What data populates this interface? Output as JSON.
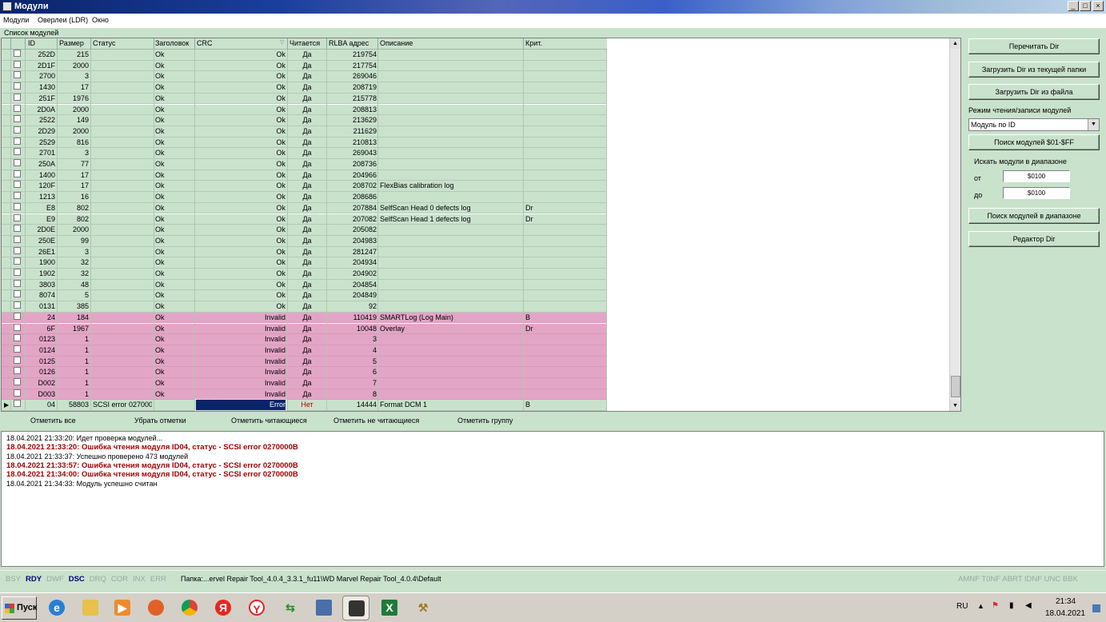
{
  "window": {
    "title": "Модули"
  },
  "menu": [
    "Модули",
    "Оверлеи (LDR)",
    "Окно"
  ],
  "list_title": "Список модулей",
  "columns": [
    "ID",
    "Размер",
    "Статус",
    "Заголовок",
    "CRC",
    "Читается",
    "RLBA адрес",
    "Описание",
    "Крит."
  ],
  "rows": [
    {
      "id": "252D",
      "size": "215",
      "status": "",
      "header": "Ok",
      "crc": "Ok",
      "readable": "Да",
      "rlba": "219754",
      "desc": "",
      "crit": "",
      "kind": "ok"
    },
    {
      "id": "2D1F",
      "size": "2000",
      "status": "",
      "header": "Ok",
      "crc": "Ok",
      "readable": "Да",
      "rlba": "217754",
      "desc": "",
      "crit": "",
      "kind": "ok"
    },
    {
      "id": "2700",
      "size": "3",
      "status": "",
      "header": "Ok",
      "crc": "Ok",
      "readable": "Да",
      "rlba": "269046",
      "desc": "",
      "crit": "",
      "kind": "ok"
    },
    {
      "id": "1430",
      "size": "17",
      "status": "",
      "header": "Ok",
      "crc": "Ok",
      "readable": "Да",
      "rlba": "208719",
      "desc": "",
      "crit": "",
      "kind": "ok"
    },
    {
      "id": "251F",
      "size": "1976",
      "status": "",
      "header": "Ok",
      "crc": "Ok",
      "readable": "Да",
      "rlba": "215778",
      "desc": "",
      "crit": "",
      "kind": "ok"
    },
    {
      "id": "2D0A",
      "size": "2000",
      "status": "",
      "header": "Ok",
      "crc": "Ok",
      "readable": "Да",
      "rlba": "208813",
      "desc": "",
      "crit": "",
      "kind": "ok"
    },
    {
      "id": "2522",
      "size": "149",
      "status": "",
      "header": "Ok",
      "crc": "Ok",
      "readable": "Да",
      "rlba": "213629",
      "desc": "",
      "crit": "",
      "kind": "ok"
    },
    {
      "id": "2D29",
      "size": "2000",
      "status": "",
      "header": "Ok",
      "crc": "Ok",
      "readable": "Да",
      "rlba": "211629",
      "desc": "",
      "crit": "",
      "kind": "ok"
    },
    {
      "id": "2529",
      "size": "816",
      "status": "",
      "header": "Ok",
      "crc": "Ok",
      "readable": "Да",
      "rlba": "210813",
      "desc": "",
      "crit": "",
      "kind": "ok"
    },
    {
      "id": "2701",
      "size": "3",
      "status": "",
      "header": "Ok",
      "crc": "Ok",
      "readable": "Да",
      "rlba": "269043",
      "desc": "",
      "crit": "",
      "kind": "ok"
    },
    {
      "id": "250A",
      "size": "77",
      "status": "",
      "header": "Ok",
      "crc": "Ok",
      "readable": "Да",
      "rlba": "208736",
      "desc": "",
      "crit": "",
      "kind": "ok"
    },
    {
      "id": "1400",
      "size": "17",
      "status": "",
      "header": "Ok",
      "crc": "Ok",
      "readable": "Да",
      "rlba": "204966",
      "desc": "",
      "crit": "",
      "kind": "ok"
    },
    {
      "id": "120F",
      "size": "17",
      "status": "",
      "header": "Ok",
      "crc": "Ok",
      "readable": "Да",
      "rlba": "208702",
      "desc": "FlexBias calibration log",
      "crit": "",
      "kind": "ok"
    },
    {
      "id": "1213",
      "size": "16",
      "status": "",
      "header": "Ok",
      "crc": "Ok",
      "readable": "Да",
      "rlba": "208686",
      "desc": "",
      "crit": "",
      "kind": "ok"
    },
    {
      "id": "E8",
      "size": "802",
      "status": "",
      "header": "Ok",
      "crc": "Ok",
      "readable": "Да",
      "rlba": "207884",
      "desc": "SelfScan Head 0 defects log",
      "crit": "Dr",
      "kind": "ok"
    },
    {
      "id": "E9",
      "size": "802",
      "status": "",
      "header": "Ok",
      "crc": "Ok",
      "readable": "Да",
      "rlba": "207082",
      "desc": "SelfScan Head 1 defects log",
      "crit": "Dr",
      "kind": "ok"
    },
    {
      "id": "2D0E",
      "size": "2000",
      "status": "",
      "header": "Ok",
      "crc": "Ok",
      "readable": "Да",
      "rlba": "205082",
      "desc": "",
      "crit": "",
      "kind": "ok"
    },
    {
      "id": "250E",
      "size": "99",
      "status": "",
      "header": "Ok",
      "crc": "Ok",
      "readable": "Да",
      "rlba": "204983",
      "desc": "",
      "crit": "",
      "kind": "ok"
    },
    {
      "id": "26E1",
      "size": "3",
      "status": "",
      "header": "Ok",
      "crc": "Ok",
      "readable": "Да",
      "rlba": "281247",
      "desc": "",
      "crit": "",
      "kind": "ok"
    },
    {
      "id": "1900",
      "size": "32",
      "status": "",
      "header": "Ok",
      "crc": "Ok",
      "readable": "Да",
      "rlba": "204934",
      "desc": "",
      "crit": "",
      "kind": "ok"
    },
    {
      "id": "1902",
      "size": "32",
      "status": "",
      "header": "Ok",
      "crc": "Ok",
      "readable": "Да",
      "rlba": "204902",
      "desc": "",
      "crit": "",
      "kind": "ok"
    },
    {
      "id": "3803",
      "size": "48",
      "status": "",
      "header": "Ok",
      "crc": "Ok",
      "readable": "Да",
      "rlba": "204854",
      "desc": "",
      "crit": "",
      "kind": "ok"
    },
    {
      "id": "8074",
      "size": "5",
      "status": "",
      "header": "Ok",
      "crc": "Ok",
      "readable": "Да",
      "rlba": "204849",
      "desc": "",
      "crit": "",
      "kind": "ok"
    },
    {
      "id": "0131",
      "size": "385",
      "status": "",
      "header": "Ok",
      "crc": "Ok",
      "readable": "Да",
      "rlba": "92",
      "desc": "",
      "crit": "",
      "kind": "ok"
    },
    {
      "id": "24",
      "size": "184",
      "status": "",
      "header": "Ok",
      "crc": "Invalid",
      "readable": "Да",
      "rlba": "110419",
      "desc": "SMARTLog (Log Main)",
      "crit": "B",
      "kind": "bad"
    },
    {
      "id": "6F",
      "size": "1967",
      "status": "",
      "header": "Ok",
      "crc": "Invalid",
      "readable": "Да",
      "rlba": "10048",
      "desc": "Overlay",
      "crit": "Dr",
      "kind": "bad"
    },
    {
      "id": "0123",
      "size": "1",
      "status": "",
      "header": "Ok",
      "crc": "Invalid",
      "readable": "Да",
      "rlba": "3",
      "desc": "",
      "crit": "",
      "kind": "bad"
    },
    {
      "id": "0124",
      "size": "1",
      "status": "",
      "header": "Ok",
      "crc": "Invalid",
      "readable": "Да",
      "rlba": "4",
      "desc": "",
      "crit": "",
      "kind": "bad"
    },
    {
      "id": "0125",
      "size": "1",
      "status": "",
      "header": "Ok",
      "crc": "Invalid",
      "readable": "Да",
      "rlba": "5",
      "desc": "",
      "crit": "",
      "kind": "bad"
    },
    {
      "id": "0126",
      "size": "1",
      "status": "",
      "header": "Ok",
      "crc": "Invalid",
      "readable": "Да",
      "rlba": "6",
      "desc": "",
      "crit": "",
      "kind": "bad"
    },
    {
      "id": "D002",
      "size": "1",
      "status": "",
      "header": "Ok",
      "crc": "Invalid",
      "readable": "Да",
      "rlba": "7",
      "desc": "",
      "crit": "",
      "kind": "bad"
    },
    {
      "id": "D003",
      "size": "1",
      "status": "",
      "header": "Ok",
      "crc": "Invalid",
      "readable": "Да",
      "rlba": "8",
      "desc": "",
      "crit": "",
      "kind": "bad"
    },
    {
      "id": "04",
      "size": "58803",
      "status": "SCSI error 027000",
      "header": "",
      "crc": "Error",
      "readable": "Нет",
      "rlba": "14444",
      "desc": "Format DCM 1",
      "crit": "B",
      "kind": "err"
    }
  ],
  "panel": {
    "reread": "Перечитать Dir",
    "load_folder": "Загрузить Dir из текущей папки",
    "load_file": "Загрузить Dir из файла",
    "mode_label": "Режим чтения/записи модулей",
    "mode_value": "Модуль по ID",
    "search_all": "Поиск модулей $01-$FF",
    "range_label": "Искать модули в диапазоне",
    "from_label": "от",
    "from_value": "$0100",
    "to_label": "до",
    "to_value": "$0100",
    "search_range": "Поиск модулей в диапазоне",
    "dir_editor": "Редактор Dir"
  },
  "actions": [
    "Отметить все",
    "Убрать отметки",
    "Отметить читающиеся",
    "Отметить не читающиеся",
    "Отметить группу"
  ],
  "log": [
    {
      "text": "18.04.2021 21:33:20: Идет проверка модулей...",
      "error": false
    },
    {
      "text": "18.04.2021 21:33:20: Ошибка чтения модуля ID04, статус - SCSI error 0270000B",
      "error": true
    },
    {
      "text": "18.04.2021 21:33:37: Успешно проверено 473 модулей",
      "error": false
    },
    {
      "text": "18.04.2021 21:33:57: Ошибка чтения модуля ID04, статус - SCSI error 0270000B",
      "error": true
    },
    {
      "text": "18.04.2021 21:34:00: Ошибка чтения модуля ID04, статус - SCSI error 0270000B",
      "error": true
    },
    {
      "text": "18.04.2021 21:34:33: Модуль успешно считан",
      "error": false
    }
  ],
  "status": {
    "flags_left": [
      {
        "t": "BSY",
        "on": false
      },
      {
        "t": "RDY",
        "on": true
      },
      {
        "t": "DWF",
        "on": false
      },
      {
        "t": "DSC",
        "on": true
      },
      {
        "t": "DRQ",
        "on": false
      },
      {
        "t": "COR",
        "on": false
      },
      {
        "t": "INX",
        "on": false
      },
      {
        "t": "ERR",
        "on": false
      }
    ],
    "folder": "Папка:...ervel Repair Tool_4.0.4_3.3.1_fu11\\WD Marvel Repair Tool_4.0.4\\Default",
    "flags_right": "AMNF T0NF ABRT IDNF UNC BBK"
  },
  "taskbar": {
    "start": "Пуск",
    "lang": "RU",
    "time": "21:34",
    "date": "18.04.2021",
    "icons": [
      "ie-icon",
      "explorer-icon",
      "media-player-icon",
      "firefox-icon",
      "chrome-icon",
      "yandex-icon",
      "yandex-browser-icon",
      "usb-icon",
      "network-icon",
      "mrt-app-icon",
      "excel-icon",
      "tools-icon"
    ]
  }
}
